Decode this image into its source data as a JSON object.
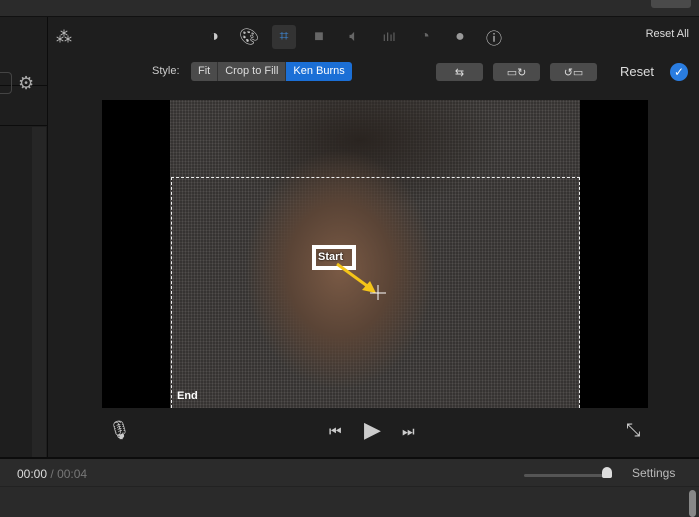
{
  "toolbar": {
    "reset_all": "Reset All",
    "icons": [
      "magic-wand-icon",
      "color-balance-icon",
      "color-correction-icon",
      "crop-icon",
      "stabilization-icon",
      "volume-icon",
      "noise-reduction-icon",
      "speed-icon",
      "clip-filter-icon",
      "info-icon"
    ],
    "active_tool": "crop-icon"
  },
  "crop": {
    "style_label": "Style:",
    "styles": [
      "Fit",
      "Crop to Fill",
      "Ken Burns"
    ],
    "selected_style": "Ken Burns",
    "reset": "Reset"
  },
  "viewer": {
    "start_label": "Start",
    "end_label": "End"
  },
  "playback": {
    "current": "00:00",
    "separator": "/",
    "duration": "00:04",
    "settings": "Settings",
    "zoom_level": 1.0
  },
  "colors": {
    "accent": "#1b6fd6",
    "arrow": "#f5c518"
  }
}
